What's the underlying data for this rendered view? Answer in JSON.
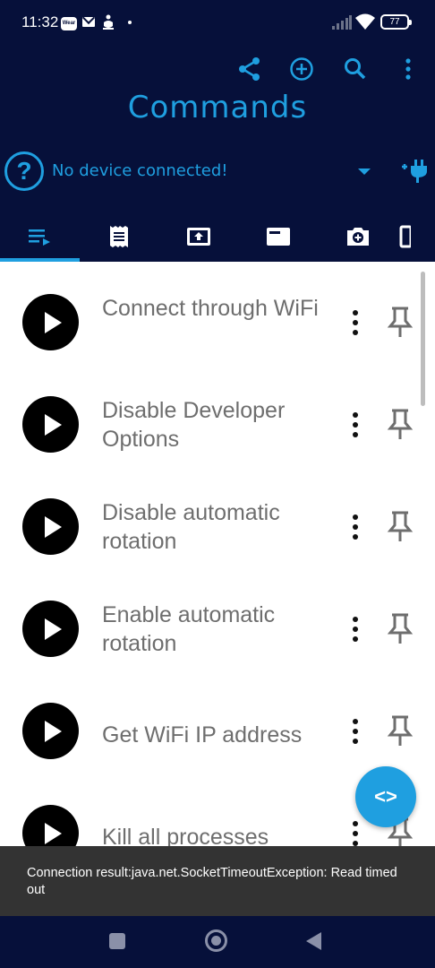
{
  "status_bar": {
    "time": "11:32",
    "wear_badge": "Wear",
    "battery": "77",
    "icons": [
      "wear-icon",
      "mail-icon",
      "robot-icon",
      "dot-icon",
      "signal-icon",
      "wifi-icon",
      "battery-icon"
    ]
  },
  "toolbar": {
    "actions": [
      "share-icon",
      "add-circle-icon",
      "search-icon",
      "more-vert-icon"
    ]
  },
  "app": {
    "title": "Commands"
  },
  "device": {
    "status": "No device connected!",
    "help_glyph": "?",
    "icons": [
      "help-icon",
      "dropdown-icon",
      "plug-icon"
    ]
  },
  "tabs": [
    {
      "icon": "playlist-icon",
      "selected": true
    },
    {
      "icon": "receipt-icon",
      "selected": false
    },
    {
      "icon": "upload-box-icon",
      "selected": false
    },
    {
      "icon": "window-icon",
      "selected": false
    },
    {
      "icon": "camera-plus-icon",
      "selected": false
    },
    {
      "icon": "frame-icon",
      "selected": false
    }
  ],
  "commands": [
    {
      "label": "Connect through WiFi"
    },
    {
      "label": "Disable Developer Options"
    },
    {
      "label": "Disable automatic rotation"
    },
    {
      "label": "Enable automatic rotation"
    },
    {
      "label": "Get WiFi IP address"
    },
    {
      "label": "Kill all processes"
    }
  ],
  "fab": {
    "label": "<>",
    "icon": "code-icon"
  },
  "snackbar": {
    "message": "Connection result:java.net.SocketTimeoutException: Read timed out"
  },
  "nav_bar": {
    "icons": [
      "recents-icon",
      "home-icon",
      "back-icon"
    ]
  },
  "colors": {
    "header_bg": "#06103a",
    "accent": "#1f9fe0",
    "text_gray": "#6e6e6e",
    "snackbar_bg": "#333333"
  }
}
